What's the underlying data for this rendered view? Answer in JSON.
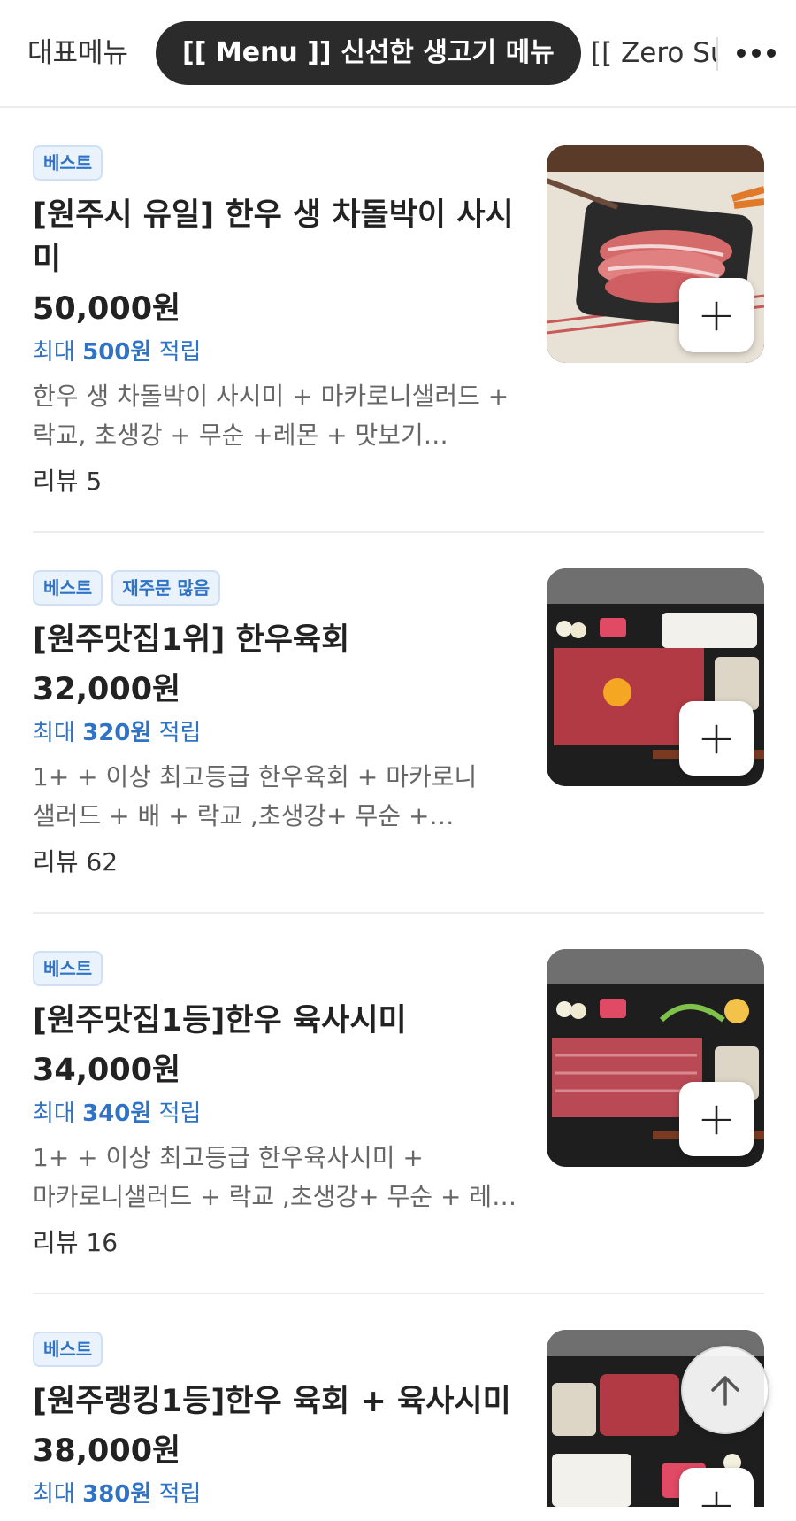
{
  "tabs": [
    {
      "label": "대표메뉴",
      "active": false
    },
    {
      "label": "[[ Menu ]] 신선한 생고기 메뉴",
      "active": true
    },
    {
      "label": "[[ Zero Su",
      "active": false
    }
  ],
  "more_icon": "more-horizontal-icon",
  "items": [
    {
      "badges": [
        "베스트"
      ],
      "name": "[원주시 유일] 한우 생 차돌박이 사시미",
      "price": "50,000원",
      "point_prefix": "최대 ",
      "point_amount": "500원",
      "point_suffix": " 적립",
      "description": "한우 생 차돌박이 사시미 + 마카로니샐러드 + 락교, 초생강 + 무순 +레몬 + 맛보기…",
      "review": "리뷰 5",
      "image": "chadol-sashimi-photo"
    },
    {
      "badges": [
        "베스트",
        "재주문 많음"
      ],
      "name": "[원주맛집1위] 한우육회",
      "price": "32,000원",
      "point_prefix": "최대 ",
      "point_amount": "320원",
      "point_suffix": " 적립",
      "description": "1+ + 이상 최고등급 한우육회 + 마카로니 샐러드 + 배 + 락교 ,초생강+ 무순 +…",
      "review": "리뷰 62",
      "image": "yukhoe-photo"
    },
    {
      "badges": [
        "베스트"
      ],
      "name": "[원주맛집1등]한우 육사시미",
      "price": "34,000원",
      "point_prefix": "최대 ",
      "point_amount": "340원",
      "point_suffix": " 적립",
      "description": "1+ + 이상 최고등급 한우육사시미 + 마카로니샐러드 + 락교 ,초생강+ 무순 + 레…",
      "review": "리뷰 16",
      "image": "yuk-sashimi-photo"
    },
    {
      "badges": [
        "베스트"
      ],
      "name": "[원주랭킹1등]한우 육회 + 육사시미",
      "price": "38,000원",
      "point_prefix": "최대 ",
      "point_amount": "380원",
      "point_suffix": " 적립",
      "description": "",
      "review": "",
      "image": "yukhoe-sashimi-set-photo"
    }
  ],
  "add_icon": "plus-icon",
  "scroll_top_icon": "arrow-up-icon",
  "colors": {
    "accent_blue": "#2f73c6",
    "active_tab": "#2b2b2b",
    "badge_bg": "#eaf2fc"
  }
}
